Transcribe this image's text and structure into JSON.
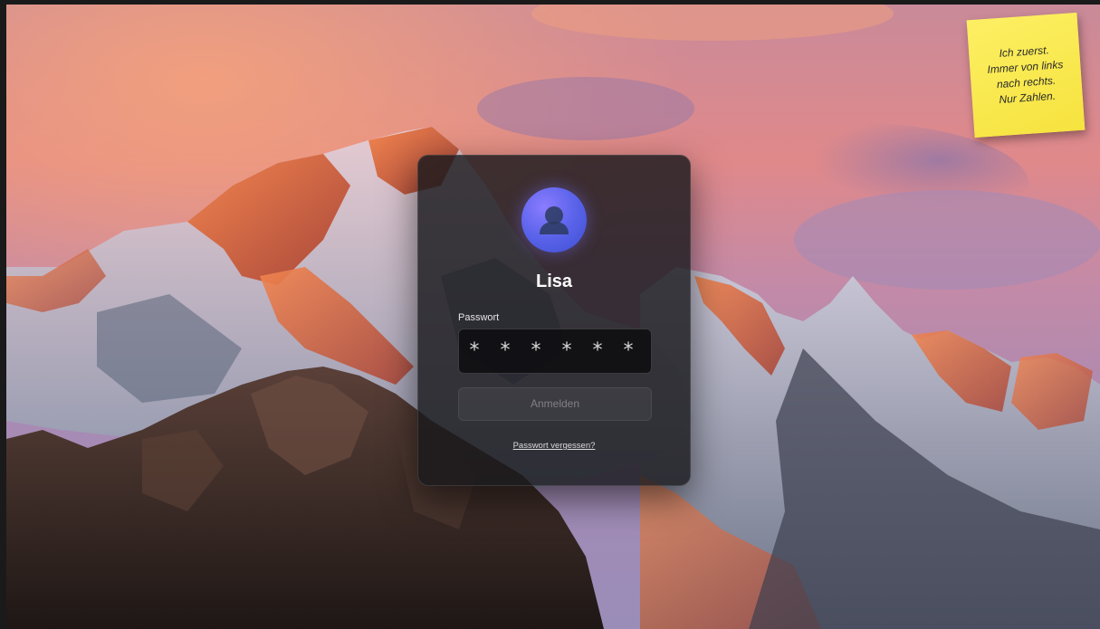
{
  "wallpaper": {
    "sky_top": "#d5838b",
    "sky_glow": "#f39a73",
    "cloud": "#a88ab8",
    "snow": "#d7dde8",
    "rock_dark": "#3b2e2c",
    "peak_light": "#f0784a"
  },
  "sticky_note": {
    "color": "#f9ea4c",
    "lines": [
      "Ich zuerst.",
      "Immer von links",
      "nach rechts.",
      "Nur Zahlen."
    ]
  },
  "login": {
    "avatar_icon": "user-silhouette-icon",
    "user_name": "Lisa",
    "password_label": "Passwort",
    "password_value": "******",
    "signin_label": "Anmelden",
    "forgot_label": "Passwort vergessen?",
    "accent": "#5a63ea"
  }
}
